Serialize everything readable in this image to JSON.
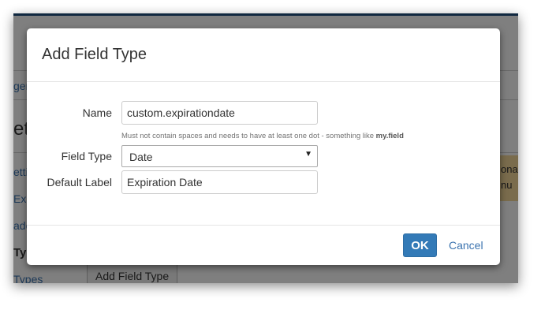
{
  "background": {
    "nav_item_1": "ger",
    "heading_fragment": "et",
    "nav_item_2": "etti",
    "nav_item_3": "Exp",
    "nav_item_4": "ade",
    "nav_item_5_bold": "Typ",
    "nav_item_6": "Types",
    "warning_line_1": "onal",
    "warning_line_2": "nu",
    "add_field_type_button": "Add Field Type"
  },
  "modal": {
    "title": "Add Field Type",
    "fields": {
      "name": {
        "label": "Name",
        "value": "custom.expirationdate"
      },
      "help_text_prefix": "Must not contain spaces and needs to have at least one dot - something like ",
      "help_text_example": "my.field",
      "field_type": {
        "label": "Field Type",
        "selected": "Date"
      },
      "default_label": {
        "label": "Default Label",
        "value": "Expiration Date"
      }
    },
    "footer": {
      "ok_label": "OK",
      "cancel_label": "Cancel"
    }
  },
  "colors": {
    "primary": "#337ab7",
    "link": "#3b73af",
    "overlay": "rgba(0,0,0,0.5)",
    "warning_bg": "#f5d89a"
  },
  "icons": {
    "select_arrow": "chevron-down-icon"
  }
}
